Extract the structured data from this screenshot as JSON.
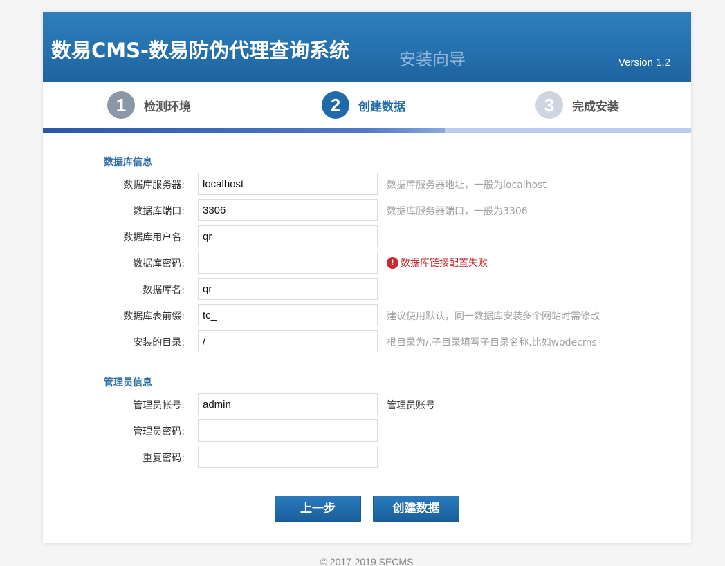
{
  "header": {
    "title": "数易CMS-数易防伪代理查询系统",
    "subtitle": "安装向导",
    "version": "Version 1.2"
  },
  "steps": [
    {
      "num": "1",
      "label": "检测环境",
      "state": "done"
    },
    {
      "num": "2",
      "label": "创建数据",
      "state": "active"
    },
    {
      "num": "3",
      "label": "完成安装",
      "state": "todo"
    }
  ],
  "db_section": {
    "title": "数据库信息",
    "fields": [
      {
        "label": "数据库服务器:",
        "value": "localhost",
        "hint": "数据库服务器地址，一般为localhost"
      },
      {
        "label": "数据库端口:",
        "value": "3306",
        "hint": "数据库服务器端口，一般为3306"
      },
      {
        "label": "数据库用户名:",
        "value": "qr",
        "hint": ""
      },
      {
        "label": "数据库密码:",
        "value": "",
        "error": "数据库链接配置失败"
      },
      {
        "label": "数据库名:",
        "value": "qr",
        "hint": ""
      },
      {
        "label": "数据库表前缀:",
        "value": "tc_",
        "hint": "建议使用默认，同一数据库安装多个网站时需修改"
      },
      {
        "label": "安装的目录:",
        "value": "/",
        "hint": "根目录为/,子目录填写子目录名称,比如wodecms"
      }
    ]
  },
  "admin_section": {
    "title": "管理员信息",
    "fields": [
      {
        "label": "管理员帐号:",
        "value": "admin",
        "hint": "管理员账号"
      },
      {
        "label": "管理员密码:",
        "value": "",
        "hint": ""
      },
      {
        "label": "重复密码:",
        "value": "",
        "hint": ""
      }
    ]
  },
  "buttons": {
    "prev": "上一步",
    "create": "创建数据"
  },
  "footer": "© 2017-2019 SECMS",
  "colors": {
    "accent": "#1f6aa8",
    "error": "#c0272d"
  }
}
